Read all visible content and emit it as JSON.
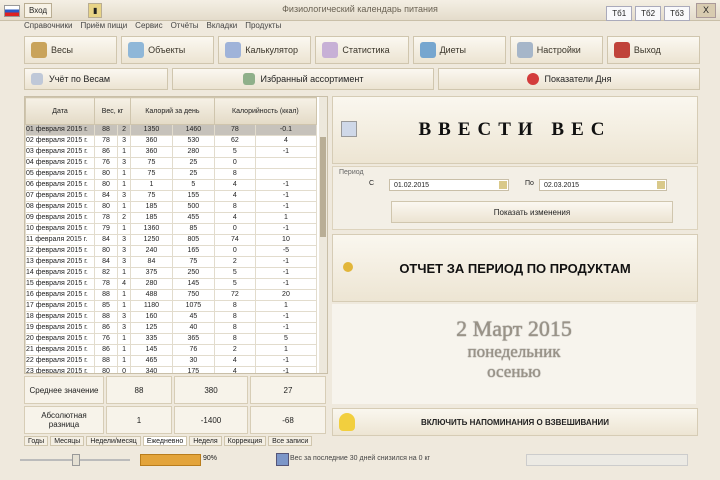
{
  "titlebar": {
    "title": "Физиологический календарь питания",
    "left_button": "Вход",
    "tabs": [
      "Тб1",
      "Тб2",
      "Тб3"
    ],
    "close": "X"
  },
  "menu": [
    "Справочники",
    "Приём пищи",
    "Сервис",
    "Отчёты",
    "Вкладки",
    "Продукты"
  ],
  "toolbar": [
    {
      "label": "Весы",
      "color": "#c9a35a"
    },
    {
      "label": "Объекты",
      "color": "#8fb7d8"
    },
    {
      "label": "Калькулятор",
      "color": "#9fb3d9"
    },
    {
      "label": "Статистика",
      "color": "#c7b0d6"
    },
    {
      "label": "Диеты",
      "color": "#76a6cf"
    },
    {
      "label": "Настройки",
      "color": "#a6b6c9"
    },
    {
      "label": "Выход",
      "color": "#c0433a"
    }
  ],
  "row2": {
    "history": "Учёт по Весам",
    "favorites": "Избранный ассортимент",
    "reminder": "Показатели Дня"
  },
  "grid": {
    "headers": [
      "Дата",
      "Вес, кг",
      "",
      "Калорий за день",
      "",
      "Калорийность (ккал)",
      ""
    ],
    "rows": [
      [
        "01 февраля 2015 г.",
        "88",
        "2",
        "1350",
        "1460",
        "78",
        "-0.1"
      ],
      [
        "02 февраля 2015 г.",
        "78",
        "3",
        "360",
        "530",
        "62",
        "4"
      ],
      [
        "03 февраля 2015 г.",
        "86",
        "1",
        "360",
        "280",
        "5",
        "-1"
      ],
      [
        "04 февраля 2015 г.",
        "76",
        "3",
        "75",
        "25",
        "0",
        ""
      ],
      [
        "05 февраля 2015 г.",
        "80",
        "1",
        "75",
        "25",
        "8",
        ""
      ],
      [
        "06 февраля 2015 г.",
        "80",
        "1",
        "1",
        "5",
        "4",
        "-1"
      ],
      [
        "07 февраля 2015 г.",
        "84",
        "3",
        "75",
        "155",
        "4",
        "-1"
      ],
      [
        "08 февраля 2015 г.",
        "80",
        "1",
        "185",
        "500",
        "8",
        "-1"
      ],
      [
        "09 февраля 2015 г.",
        "78",
        "2",
        "185",
        "455",
        "4",
        "1"
      ],
      [
        "10 февраля 2015 г.",
        "79",
        "1",
        "1360",
        "85",
        "0",
        "-1"
      ],
      [
        "11 февраля 2015 г.",
        "84",
        "3",
        "1250",
        "805",
        "74",
        "10"
      ],
      [
        "12 февраля 2015 г.",
        "80",
        "3",
        "240",
        "165",
        "0",
        "-5"
      ],
      [
        "13 февраля 2015 г.",
        "84",
        "3",
        "84",
        "75",
        "2",
        "-1"
      ],
      [
        "14 февраля 2015 г.",
        "82",
        "1",
        "375",
        "250",
        "5",
        "-1"
      ],
      [
        "15 февраля 2015 г.",
        "78",
        "4",
        "280",
        "145",
        "5",
        "-1"
      ],
      [
        "16 февраля 2015 г.",
        "88",
        "1",
        "488",
        "750",
        "72",
        "20"
      ],
      [
        "17 февраля 2015 г.",
        "85",
        "1",
        "1180",
        "1075",
        "8",
        "1"
      ],
      [
        "18 февраля 2015 г.",
        "88",
        "3",
        "160",
        "45",
        "8",
        "-1"
      ],
      [
        "19 февраля 2015 г.",
        "86",
        "3",
        "125",
        "40",
        "8",
        "-1"
      ],
      [
        "20 февраля 2015 г.",
        "76",
        "1",
        "335",
        "365",
        "8",
        "5"
      ],
      [
        "21 февраля 2015 г.",
        "86",
        "1",
        "145",
        "76",
        "2",
        "1"
      ],
      [
        "22 февраля 2015 г.",
        "88",
        "1",
        "465",
        "30",
        "4",
        "-1"
      ],
      [
        "23 февраля 2015 г.",
        "80",
        "0",
        "340",
        "175",
        "4",
        "-1"
      ],
      [
        "24 февраля 2015 г.",
        "88",
        "1",
        "165",
        "65",
        "8",
        "-1"
      ],
      [
        "25 февраля 2015 г.",
        "80",
        "3",
        "165",
        "265",
        "0",
        "-1"
      ],
      [
        "26 февраля 2015 г.",
        "80",
        "1",
        "335",
        "75",
        "8",
        "-1"
      ],
      [
        "27 февраля 2015 г.",
        "78",
        "1",
        "430",
        "180",
        "10",
        "-1"
      ],
      [
        "28 февраля 2015 г.",
        "76",
        "3",
        "230",
        "55",
        "4",
        "-1"
      ],
      [
        "01 марта 2015 г.",
        "78",
        "4",
        "165",
        "75",
        "8",
        "-1"
      ],
      [
        "02 марта 2015 г.",
        "86",
        "3",
        "140",
        "75",
        "8",
        "-1"
      ]
    ]
  },
  "summary": {
    "avg_label": "Среднее значение",
    "avg_values": [
      "88",
      "380",
      "27"
    ],
    "total_label": "Абсолютная разница",
    "total_values": [
      "1",
      "-1400",
      "-68"
    ]
  },
  "bottom_tabs": [
    "Годы",
    "Месяцы",
    "Недели/месяц",
    "Ежедневно",
    "Неделя",
    "Коррекция",
    "Все записи"
  ],
  "right": {
    "enter_weight": "ВВЕСТИ ВЕС",
    "period_label": "Период",
    "from_label": "С",
    "from_date": "01.02.2015",
    "to_label": "По",
    "to_date": "02.03.2015",
    "show_button": "Показать изменения",
    "report_button": "ОТЧЕТ ЗА ПЕРИОД ПО ПРОДУКТАМ",
    "date_line1": "2 Март 2015",
    "date_line2": "понедельник",
    "date_line3": "осенью",
    "reminders_button": "ВКЛЮЧИТЬ НАПОМИНАНИЯ О ВЗВЕШИВАНИИ"
  },
  "statusbar": {
    "progress": 0.9,
    "percent": "90%",
    "message": "Вес за последние 30 дней снизился на 0 кг"
  }
}
